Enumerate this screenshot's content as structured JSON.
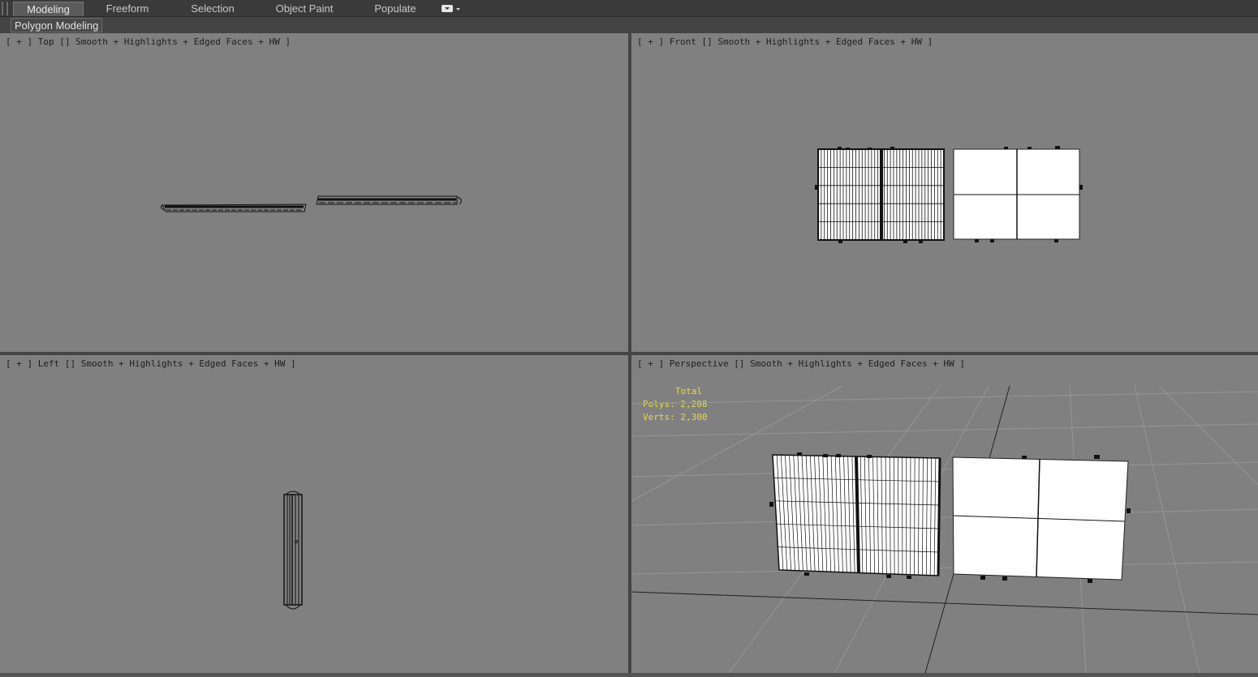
{
  "ribbon": {
    "tabs": [
      {
        "label": "Modeling",
        "active": true
      },
      {
        "label": "Freeform",
        "active": false
      },
      {
        "label": "Selection",
        "active": false
      },
      {
        "label": "Object Paint",
        "active": false
      },
      {
        "label": "Populate",
        "active": false
      }
    ],
    "dropdown_icon": "panel-options-icon"
  },
  "subbar": {
    "label": "Polygon Modeling"
  },
  "viewports": {
    "top": {
      "label": "[ + ] Top [] Smooth + Highlights + Edged Faces + HW ]"
    },
    "front": {
      "label": "[ + ] Front [] Smooth + Highlights + Edged Faces + HW ]"
    },
    "left": {
      "label": "[ + ] Left [] Smooth + Highlights + Edged Faces + HW ]"
    },
    "perspective": {
      "label": "[ + ] Perspective [] Smooth + Highlights + Edged Faces + HW ]"
    }
  },
  "stats": {
    "total_label": "Total",
    "polys": "Polys: 2,208",
    "verts": "Verts: 2,300"
  },
  "colors": {
    "viewport_bg": "#808080",
    "ui_bg": "#444444",
    "stats_text": "#e8d94a",
    "wire": "#111111",
    "face": "#ffffff"
  }
}
